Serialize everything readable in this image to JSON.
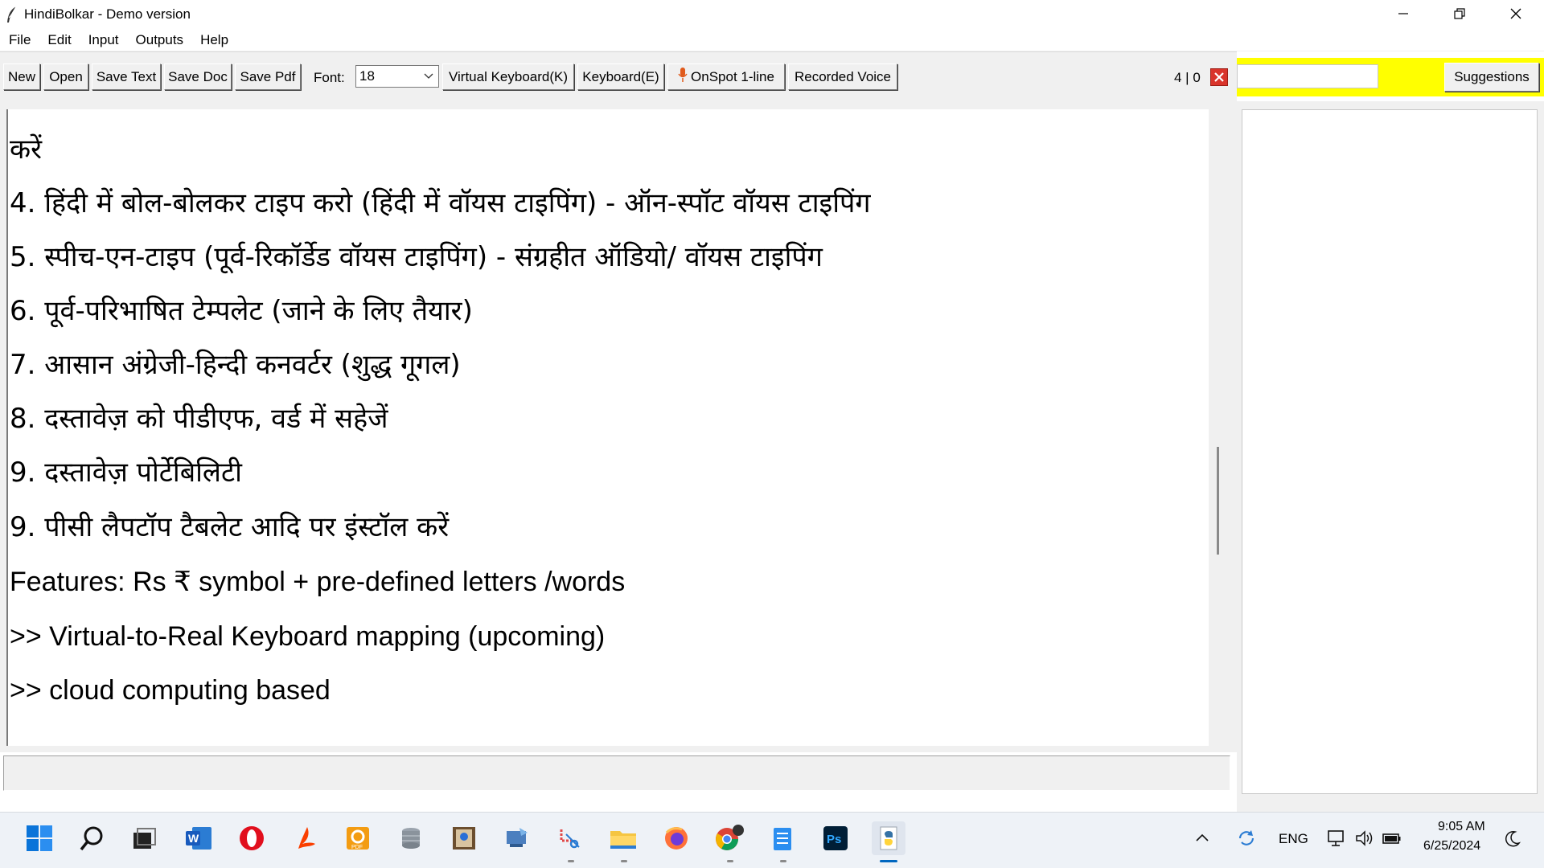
{
  "window": {
    "title": "HindiBolkar - Demo version"
  },
  "menu": [
    "File",
    "Edit",
    "Input",
    "Outputs",
    "Help"
  ],
  "toolbar": {
    "new": "New",
    "open": "Open",
    "save_text": "Save Text",
    "save_doc": "Save Doc",
    "save_pdf": "Save Pdf",
    "font_label": "Font:",
    "font_size": "18",
    "virtual_keyboard": "Virtual Keyboard(K)",
    "keyboard": "Keyboard(E)",
    "onspot": "OnSpot 1-line",
    "recorded_voice": "Recorded Voice",
    "counter": "4 | 0"
  },
  "suggestions": {
    "button": "Suggestions",
    "input_value": ""
  },
  "editor": {
    "top_partial": "करें",
    "lines": [
      "4. हिंदी में बोल-बोलकर टाइप करो (हिंदी में वॉयस टाइपिंग) - ऑन-स्पॉट वॉयस टाइपिंग",
      "5. स्पीच-एन-टाइप (पूर्व-रिकॉर्डेड वॉयस टाइपिंग) - संग्रहीत ऑडियो/ वॉयस टाइपिंग",
      "6. पूर्व-परिभाषित टेम्पलेट (जाने के लिए तैयार)",
      "7. आसान अंग्रेजी-हिन्दी कनवर्टर (शुद्ध गूगल)",
      "8. दस्तावेज़ को पीडीएफ, वर्ड में सहेजें",
      "9. दस्तावेज़ पोर्टेबिलिटी",
      "9. पीसी लैपटॉप टैबलेट आदि पर इंस्टॉल करें",
      "Features: Rs ₹ symbol + pre-defined letters /words",
      ">> Virtual-to-Real Keyboard mapping (upcoming)",
      ">> cloud computing based"
    ]
  },
  "taskbar": {
    "apps": [
      "start-icon",
      "search-icon",
      "task-view-icon",
      "word-icon",
      "opera-icon",
      "acrobat-icon",
      "pdf-tool-icon",
      "database-icon",
      "certificate-icon",
      "network-app-icon",
      "snipping-tool-icon",
      "file-explorer-icon",
      "firefox-icon",
      "chrome-icon",
      "notepad-icon",
      "photoshop-icon",
      "python-app-icon"
    ],
    "language": "ENG",
    "time": "9:05 AM",
    "date": "6/25/2024"
  },
  "colors": {
    "suggestion_bar": "#ffff00",
    "close_red": "#d9342b",
    "toolbar_bg": "#f0f0f0",
    "taskbar_bg": "#eef2f7"
  }
}
